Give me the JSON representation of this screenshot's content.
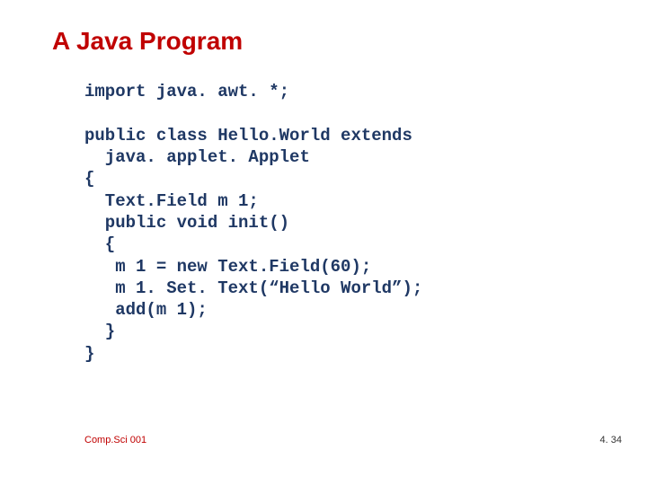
{
  "title": "A Java Program",
  "code": "import java. awt. *;\n\npublic class Hello.World extends\n  java. applet. Applet\n{\n  Text.Field m 1;\n  public void init()\n  {\n   m 1 = new Text.Field(60);\n   m 1. Set. Text(“Hello World”);\n   add(m 1);\n  }\n}",
  "footer": {
    "left": "Comp.Sci 001",
    "right": "4. 34"
  }
}
